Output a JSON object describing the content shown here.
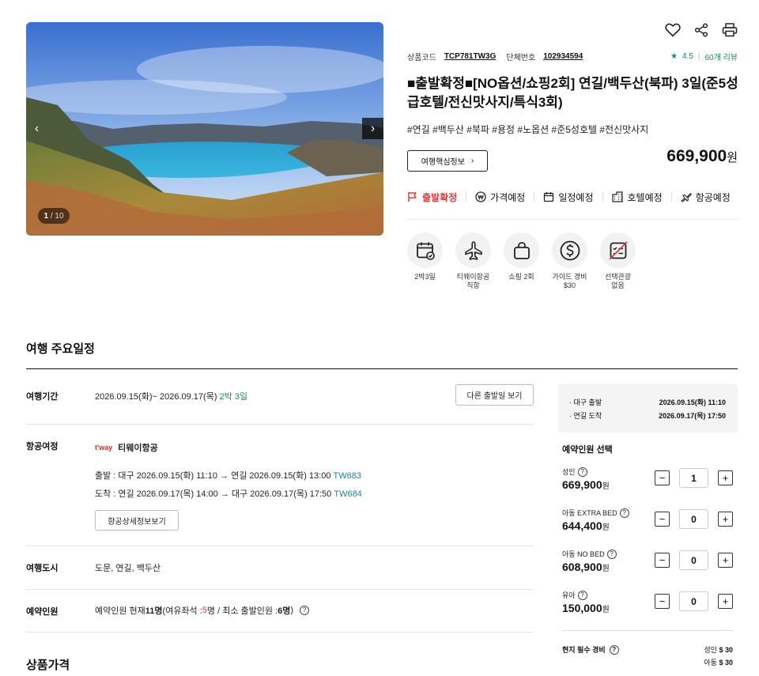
{
  "hero": {
    "counter_current": "1",
    "counter_total": "/ 10"
  },
  "codes": {
    "product_code_label": "상품코드",
    "product_code": "TCP781TW3G",
    "group_no_label": "단체번호",
    "group_no": "102934594"
  },
  "rating": {
    "star": "★",
    "score": "4.5",
    "sep": "|",
    "reviews": "60개 리뷰"
  },
  "title": "■출발확정■[NO옵션/쇼핑2회] 연길/백두산(북파) 3일(준5성급호텔/전신맛사지/특식3회)",
  "tags": "#연길 #백두산 #북파 #용정 #노옵션 #준5성호텔 #전신맛사지",
  "key_info_button": "여행핵심정보",
  "key_info_chevron": "›",
  "price": {
    "amount": "669,900",
    "unit": "원"
  },
  "status_items": [
    {
      "label": "출발확정",
      "icon": "flag-icon"
    },
    {
      "label": "가격예정",
      "icon": "won-icon"
    },
    {
      "label": "일정예정",
      "icon": "calendar-icon"
    },
    {
      "label": "호텔예정",
      "icon": "hotel-icon"
    },
    {
      "label": "항공예정",
      "icon": "plane-icon"
    }
  ],
  "features": [
    {
      "line1": "2박3일",
      "line2": "",
      "icon": "calendar-check-icon"
    },
    {
      "line1": "티웨이항공",
      "line2": "직항",
      "icon": "airplane-icon"
    },
    {
      "line1": "쇼핑 2회",
      "line2": "",
      "icon": "shopping-bag-icon"
    },
    {
      "line1": "가이드 경비",
      "line2": "$30",
      "icon": "dollar-icon"
    },
    {
      "line1": "선택관광",
      "line2": "없음",
      "icon": "no-optional-tour-icon"
    }
  ],
  "itinerary": {
    "section_title": "여행 주요일정",
    "period": {
      "label": "여행기간",
      "dates": "2026.09.15(화)~ 2026.09.17(목)",
      "nights": "2박 3일",
      "other_dates_button": "다른 출발일 보기"
    },
    "flight": {
      "label": "항공여정",
      "logo": "t'way",
      "airline": "티웨이항공",
      "outbound": "출발 : 대구 2026.09.15(화) 11:10 → 연길 2026.09.15(화) 13:00",
      "outbound_no": "TW683",
      "inbound": "도착 : 연길 2026.09.17(목) 14:00 → 대구 2026.09.17(목) 17:50",
      "inbound_no": "TW684",
      "detail_button": "항공상세정보보기"
    },
    "cities": {
      "label": "여행도시",
      "value": "도문, 연길, 백두산"
    },
    "booking": {
      "label": "예약인원",
      "prefix": "예약인원 현재 ",
      "current": "11명",
      "mid": "(여유좌석 : ",
      "seats": "5",
      "mid2": "명 / 최소 출발인원 : ",
      "min": "6명",
      "suffix": ")"
    }
  },
  "product_price_title": "상품가격",
  "flight_box": {
    "dep_label": "· 대구 출발",
    "dep_value": "2026.09.15(화) 11:10",
    "arr_label": "· 연길 도착",
    "arr_value": "2026.09.17(목) 17:50"
  },
  "booking_panel": {
    "title": "예약인원 선택",
    "pax": [
      {
        "label": "성인",
        "price": "669,900",
        "unit": "원",
        "count": "1"
      },
      {
        "label": "아동 EXTRA BED",
        "price": "644,400",
        "unit": "원",
        "count": "0"
      },
      {
        "label": "아동 NO BED",
        "price": "608,900",
        "unit": "원",
        "count": "0"
      },
      {
        "label": "유아",
        "price": "150,000",
        "unit": "원",
        "count": "0"
      }
    ],
    "fee_label": "현지 필수 경비",
    "fee_adult_label": "성인",
    "fee_adult": "$ 30",
    "fee_child_label": "아동",
    "fee_child": "$ 30"
  },
  "symbols": {
    "question": "?",
    "minus": "−",
    "plus": "+",
    "prev": "‹",
    "next": "›"
  }
}
